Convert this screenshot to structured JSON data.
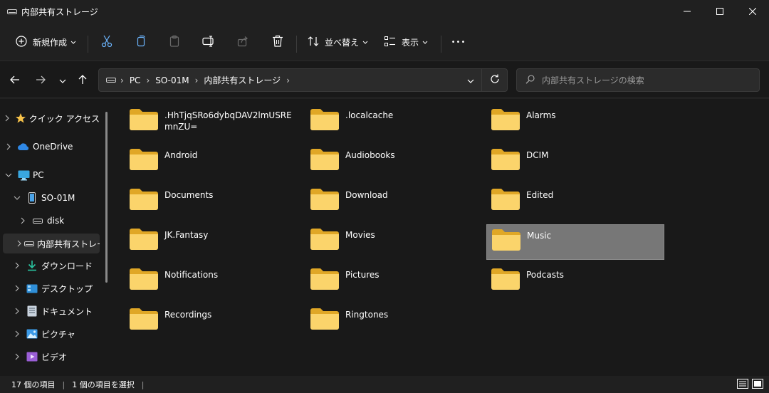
{
  "window": {
    "title": "内部共有ストレージ"
  },
  "toolbar": {
    "new_label": "新規作成",
    "sort_label": "並べ替え",
    "view_label": "表示",
    "more_label": "•••"
  },
  "address": {
    "crumbs": [
      "PC",
      "SO-01M",
      "内部共有ストレージ"
    ]
  },
  "search": {
    "placeholder": "内部共有ストレージの検索"
  },
  "sidebar": {
    "items": [
      {
        "label": "クイック アクセス",
        "icon": "star-icon"
      },
      {
        "label": "OneDrive",
        "icon": "cloud-icon"
      },
      {
        "label": "PC",
        "icon": "monitor-icon"
      },
      {
        "label": "SO-01M",
        "icon": "phone-icon"
      },
      {
        "label": "disk",
        "icon": "drive-icon"
      },
      {
        "label": "内部共有ストレージ",
        "icon": "drive-icon"
      },
      {
        "label": "ダウンロード",
        "icon": "download-icon"
      },
      {
        "label": "デスクトップ",
        "icon": "desktop-icon"
      },
      {
        "label": "ドキュメント",
        "icon": "document-icon"
      },
      {
        "label": "ピクチャ",
        "icon": "picture-icon"
      },
      {
        "label": "ビデオ",
        "icon": "video-icon"
      }
    ]
  },
  "folders": [
    {
      "name": ".HhTjqSRo6dybqDAV2lmUSREmnZU="
    },
    {
      "name": ".localcache"
    },
    {
      "name": "Alarms"
    },
    {
      "name": "Android"
    },
    {
      "name": "Audiobooks"
    },
    {
      "name": "DCIM"
    },
    {
      "name": "Documents"
    },
    {
      "name": "Download"
    },
    {
      "name": "Edited"
    },
    {
      "name": "JK.Fantasy"
    },
    {
      "name": "Movies"
    },
    {
      "name": "Music"
    },
    {
      "name": "Notifications"
    },
    {
      "name": "Pictures"
    },
    {
      "name": "Podcasts"
    },
    {
      "name": "Recordings"
    },
    {
      "name": "Ringtones"
    }
  ],
  "status": {
    "count": "17 個の項目",
    "selected": "1 個の項目を選択"
  },
  "colors": {
    "accent": "#4cc2ff",
    "folder": "#f8c34a",
    "selection": "#777777"
  }
}
